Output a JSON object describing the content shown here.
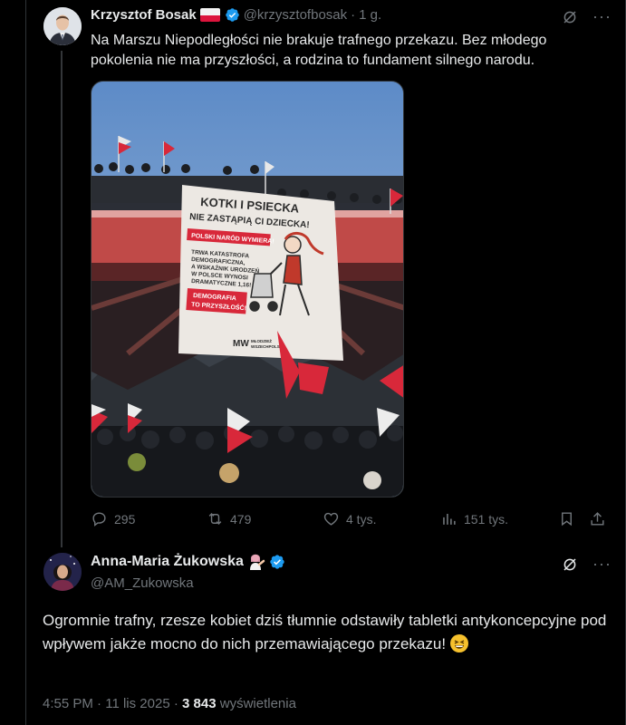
{
  "quoted_tweet": {
    "author_name": "Krzysztof Bosak",
    "flag": "poland-flag",
    "handle": "@krzysztofbosak",
    "separator": "·",
    "age": "1 g.",
    "text": "Na Marszu Niepodległości nie brakuje trafnego przekazu. Bez młodego pokolenia nie ma przyszłości, a rodzina to fundament silnego narodu.",
    "image": {
      "banner_title_line1": "KOTKI I PSIECKA",
      "banner_title_line2": "NIE ZASTĄPIĄ CI DZIECKA!",
      "banner_tag1": "POLSKI NARÓD WYMIERA!",
      "banner_body_line1": "TRWA KATASTROFA",
      "banner_body_line2": "DEMOGRAFICZNA,",
      "banner_body_line3": "A WSKAŹNIK URODZEŃ",
      "banner_body_line4": "W POLSCE WYNOSI",
      "banner_body_line5": "DRAMATYCZNE 1,16!",
      "banner_tag2_line1": "DEMOGRAFIA",
      "banner_tag2_line2": "TO PRZYSZŁOŚĆ!",
      "banner_logo": "MW",
      "banner_logo_text_line1": "MŁODZIEŻ",
      "banner_logo_text_line2": "WSZECHPOLSKA"
    },
    "actions": {
      "replies": "295",
      "reposts": "479",
      "likes": "4 tys.",
      "views": "151 tys."
    }
  },
  "main_tweet": {
    "author_name": "Anna-Maria Żukowska",
    "name_emoji": "person-tipping-hand-emoji",
    "handle": "@AM_Zukowska",
    "text": "Ogromnie trafny, rzesze kobiet dziś tłumnie odstawiły tabletki antykoncepcyjne pod wpływem jakże mocno do nich przemawiającego przekazu!",
    "text_emoji": "grinning-squinting-face-emoji",
    "time": "4:55 PM",
    "dot": "·",
    "date": "11 lis 2025",
    "views_count": "3 843",
    "views_label": "wyświetlenia"
  },
  "colors": {
    "background": "#000000",
    "text": "#e7e9ea",
    "secondary_text": "#71767b",
    "verified": "#1d9bf0",
    "border": "#2f3336"
  }
}
